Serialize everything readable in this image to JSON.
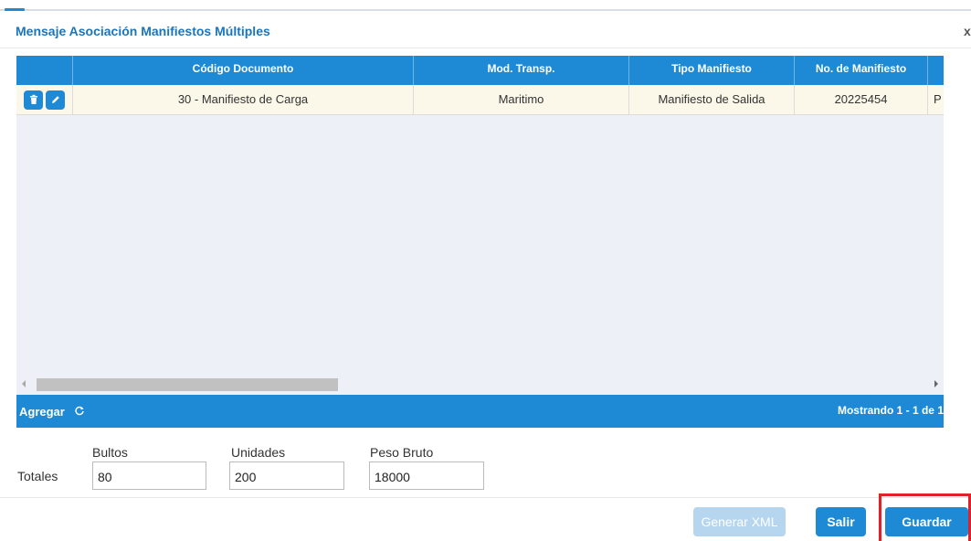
{
  "dialog": {
    "title": "Mensaje Asociación Manifiestos Múltiples",
    "close_glyph": "x"
  },
  "grid": {
    "columns": [
      "",
      "Código Documento",
      "Mod. Transp.",
      "Tipo Manifiesto",
      "No. de Manifiesto",
      ""
    ],
    "rows": [
      {
        "actions": [
          "trash-icon",
          "pencil-icon"
        ],
        "codigo_documento": "30 - Manifiesto de Carga",
        "mod_transp": "Maritimo",
        "tipo_manifiesto": "Manifiesto de Salida",
        "no_manifiesto": "20225454",
        "extra": "P"
      }
    ],
    "footer": {
      "add_label": "Agregar",
      "refresh_icon": "refresh-icon",
      "paging_text": "Mostrando 1 - 1 de 1"
    }
  },
  "totals": {
    "label": "Totales",
    "bultos": {
      "label": "Bultos",
      "value": "80"
    },
    "unidades": {
      "label": "Unidades",
      "value": "200"
    },
    "peso_bruto": {
      "label": "Peso Bruto",
      "value": "18000"
    }
  },
  "buttons": {
    "generar_xml": "Generar XML",
    "salir": "Salir",
    "guardar": "Guardar"
  },
  "colors": {
    "accent": "#1e8ad6",
    "title": "#1b75bb",
    "row_highlight": "#fbf8e9",
    "annotation": "#e0202b"
  }
}
